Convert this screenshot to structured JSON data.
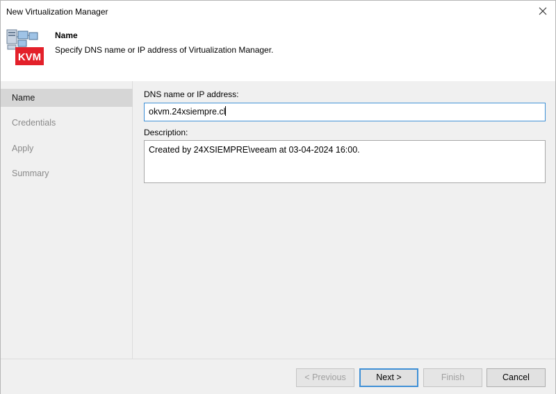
{
  "window": {
    "title": "New Virtualization Manager"
  },
  "header": {
    "title": "Name",
    "subtitle": "Specify DNS name or IP address of Virtualization Manager.",
    "icon_badge": "KVM"
  },
  "steps": [
    {
      "label": "Name",
      "active": true
    },
    {
      "label": "Credentials",
      "active": false
    },
    {
      "label": "Apply",
      "active": false
    },
    {
      "label": "Summary",
      "active": false
    }
  ],
  "form": {
    "dns_label": "DNS name or IP address:",
    "dns_value": "okvm.24xsiempre.cl",
    "description_label": "Description:",
    "description_value": "Created by 24XSIEMPRE\\veeam at 03-04-2024 16:00."
  },
  "buttons": {
    "previous": "< Previous",
    "next": "Next >",
    "finish": "Finish",
    "cancel": "Cancel"
  },
  "colors": {
    "kvm_badge": "#e3202a",
    "focus_border": "#3d8fd6",
    "active_step_bg": "#d6d6d6"
  }
}
